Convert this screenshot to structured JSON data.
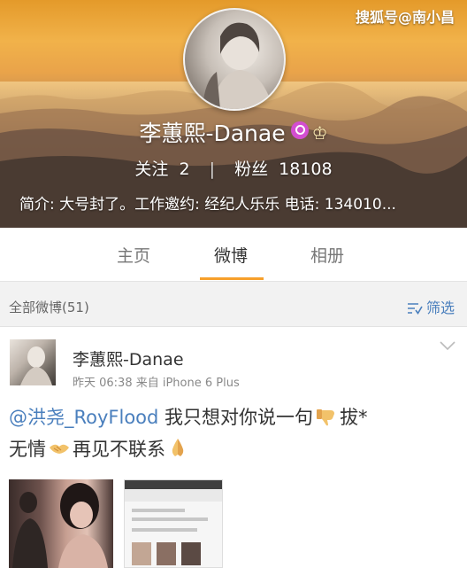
{
  "watermark": "搜狐号@南小昌",
  "profile": {
    "name": "李蕙熙-Danae",
    "following_label": "关注",
    "following_count": "2",
    "followers_label": "粉丝",
    "followers_count": "18108",
    "bio": "简介: 大号封了。工作邀约: 经纪人乐乐 电话: 134010..."
  },
  "tabs": [
    {
      "label": "主页",
      "active": false
    },
    {
      "label": "微博",
      "active": true
    },
    {
      "label": "相册",
      "active": false
    }
  ],
  "filterbar": {
    "all_label": "全部微博(51)",
    "filter_label": "筛选"
  },
  "post": {
    "author": "李蕙熙-Danae",
    "meta": "昨天 06:38  来自 iPhone 6 Plus",
    "mention": "@洪尧_RoyFlood",
    "text_part1": " 我只想对你说一句",
    "text_part2": "拔*",
    "text_part3": "无情",
    "text_part4": "再见不联系"
  },
  "colors": {
    "accent": "#f7a02b",
    "link": "#4a7fbd"
  }
}
